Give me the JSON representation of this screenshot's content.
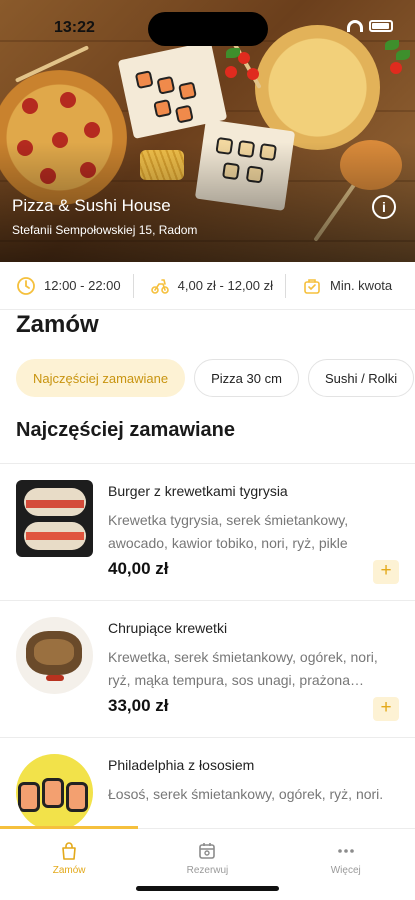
{
  "status_bar": {
    "time": "13:22"
  },
  "restaurant": {
    "name": "Pizza & Sushi House",
    "address": "Stefanii Sempołowskiej 15, Radom",
    "info_icon": "i"
  },
  "info_strip": {
    "hours": "12:00 - 22:00",
    "delivery": "4,00 zł - 12,00 zł",
    "minimum": "Min. kwota"
  },
  "section_title": "Zamów",
  "categories": [
    "Najczęściej zamawiane",
    "Pizza 30 cm",
    "Sushi / Rolki"
  ],
  "list_heading": "Najczęściej zamawiane",
  "products": [
    {
      "name": "Burger z krewetkami tygrysia",
      "description": "Krewetka tygrysia, serek śmietankowy, awocado, kawior tobiko, nori, ryż, pikle",
      "price": "40,00 zł"
    },
    {
      "name": "Chrupiące krewetki",
      "description": "Krewetka, serek śmietankowy, ogórek, nori, ryż, mąka tempura, sos unagi, prażona cebula",
      "price": "33,00 zł"
    },
    {
      "name": "Philadelphia z łososiem",
      "description": "Łosoś, serek śmietankowy, ogórek, ryż, nori.",
      "price": ""
    }
  ],
  "add_symbol": "+",
  "bottom_nav": {
    "tabs": [
      {
        "label": "Zamów",
        "icon": "bag-icon"
      },
      {
        "label": "Rezerwuj",
        "icon": "calendar-icon"
      },
      {
        "label": "Więcej",
        "icon": "more-icon"
      }
    ]
  },
  "colors": {
    "accent": "#f5c03d",
    "accent_light": "#fdf2d4",
    "accent_text": "#e3a91a"
  }
}
